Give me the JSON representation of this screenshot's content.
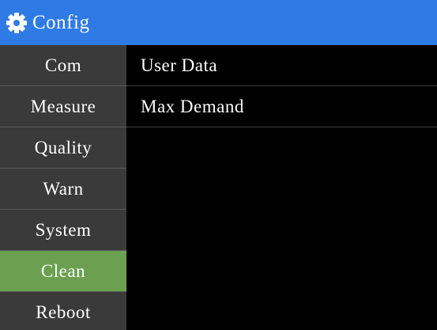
{
  "header": {
    "icon": "gear-icon",
    "title": "Config",
    "color": "#2f7be6"
  },
  "sidebar": {
    "active_color": "#6aa04f",
    "items": [
      {
        "label": "Com"
      },
      {
        "label": "Measure"
      },
      {
        "label": "Quality"
      },
      {
        "label": "Warn"
      },
      {
        "label": "System"
      },
      {
        "label": "Clean",
        "active": true
      },
      {
        "label": "Reboot"
      }
    ]
  },
  "main": {
    "rows": [
      {
        "label": "User Data"
      },
      {
        "label": "Max Demand"
      }
    ]
  }
}
